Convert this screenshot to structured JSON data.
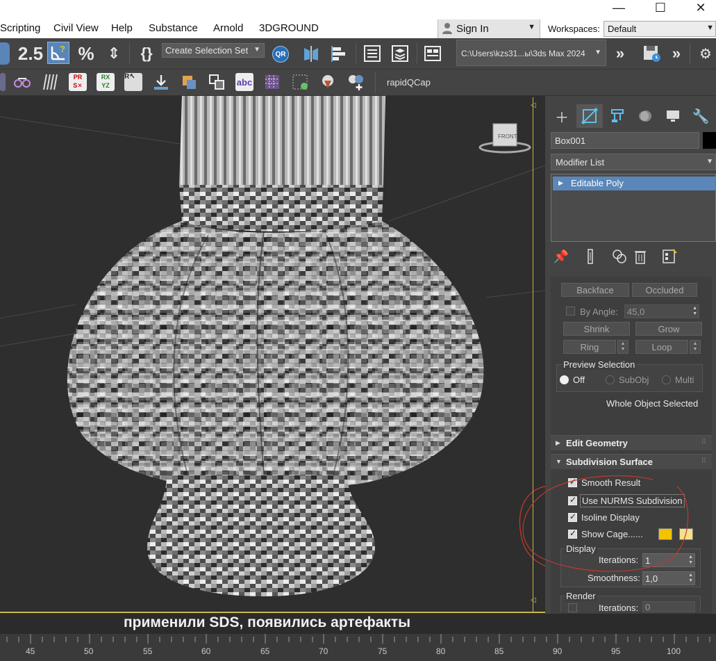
{
  "window": {
    "minimize_glyph": "—",
    "maximize_glyph": "☐",
    "close_glyph": "✕"
  },
  "menu": {
    "items": [
      "Scripting",
      "Civil View",
      "Help",
      "Substance",
      "Arnold",
      "3DGROUND"
    ],
    "sign_in": "Sign In",
    "workspaces_label": "Workspaces:",
    "workspace_value": "Default"
  },
  "toolbar": {
    "selection_set_placeholder": "Create Selection Set",
    "project_path": "C:\\Users\\kzs31...ы\\3ds Max 2024",
    "snap_label": "2.5",
    "qr_label": "QR",
    "rapid_label": "rapidQCap",
    "icons": [
      "angle-snap-icon",
      "percent-snap-icon",
      "spinner-snap-icon",
      "named-selection-icon",
      "mirror-icon",
      "align-icon",
      "scene-explorer-icon",
      "layer-explorer-icon",
      "ribbon-icon",
      "save-icon"
    ]
  },
  "viewport": {
    "caption": "применили SDS, появились артефакты",
    "viewcube_label": "FRONT"
  },
  "timeline": {
    "ticks": [
      "45",
      "50",
      "55",
      "60",
      "65",
      "70",
      "75",
      "80",
      "85",
      "90",
      "95",
      "100"
    ]
  },
  "command_panel": {
    "tabs": [
      "create-icon",
      "modify-icon",
      "hierarchy-icon",
      "motion-icon",
      "display-icon",
      "utilities-icon"
    ],
    "object_name": "Box001",
    "object_color": "#000000",
    "modifier_list_label": "Modifier List",
    "stack": [
      {
        "label": "Editable Poly",
        "selected": true
      }
    ],
    "selection": {
      "backface": "Backface",
      "occluded": "Occluded",
      "by_angle_label": "By Angle:",
      "by_angle_value": "45,0",
      "shrink": "Shrink",
      "grow": "Grow",
      "ring": "Ring",
      "loop": "Loop",
      "preview_title": "Preview Selection",
      "preview_options": [
        "Off",
        "SubObj",
        "Multi"
      ],
      "preview_selected": "Off",
      "status": "Whole Object Selected"
    },
    "rollouts": {
      "edit_geometry": "Edit Geometry",
      "subdivision_surface": "Subdivision Surface"
    },
    "subdivision": {
      "smooth_result": "Smooth Result",
      "use_nurms": "Use NURMS Subdivision",
      "isoline_display": "Isoline Display",
      "show_cage": "Show Cage......",
      "cage_color_1": "#f4c300",
      "cage_color_2": "#f7e08a",
      "display_group": "Display",
      "iterations_label": "Iterations:",
      "display_iterations": "1",
      "smoothness_label": "Smoothness:",
      "display_smoothness": "1,0",
      "render_group": "Render",
      "render_iterations": "0"
    }
  }
}
